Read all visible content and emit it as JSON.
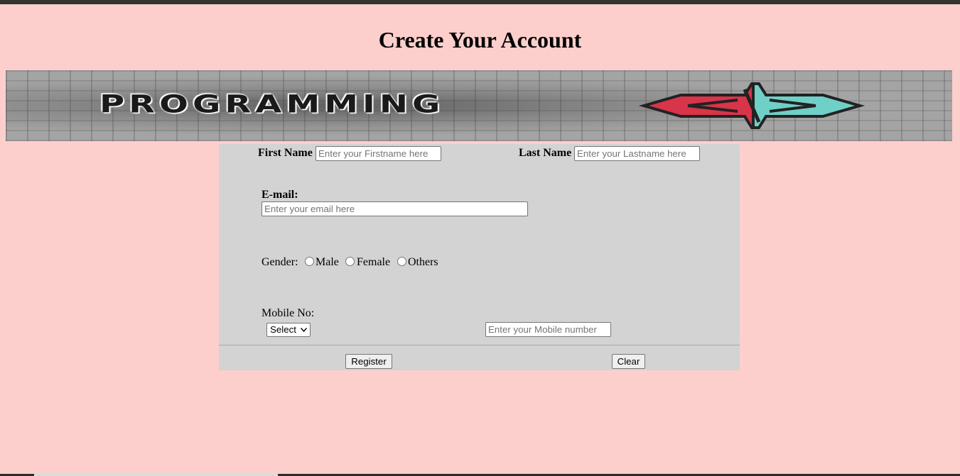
{
  "page": {
    "title": "Create Your Account"
  },
  "banner": {
    "text": "PROGRAMMING",
    "logo_icon": "code-brackets-logo-icon",
    "colors": {
      "left": "#d8344a",
      "right": "#6fd0c8"
    }
  },
  "form": {
    "first_name": {
      "label": "First Name",
      "placeholder": "Enter your Firstname here",
      "value": ""
    },
    "last_name": {
      "label": "Last Name",
      "placeholder": "Enter your Lastname here",
      "value": ""
    },
    "email": {
      "label": "E-mail:",
      "placeholder": "Enter your email here",
      "value": ""
    },
    "gender": {
      "label": "Gender:",
      "options": [
        "Male",
        "Female",
        "Others"
      ],
      "selected": null
    },
    "mobile": {
      "label": "Mobile No:",
      "code_select": {
        "selected": "Select"
      },
      "placeholder": "Enter your Mobile number",
      "value": ""
    },
    "buttons": {
      "register": "Register",
      "clear": "Clear"
    }
  },
  "colors": {
    "page_background": "#fccfcc",
    "form_background": "#d3d3d3"
  }
}
